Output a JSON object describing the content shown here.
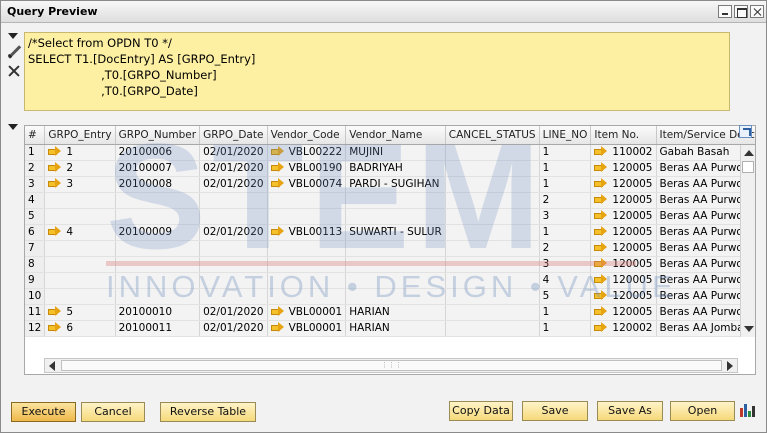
{
  "window": {
    "title": "Query Preview"
  },
  "query": {
    "lines": [
      "/*Select from OPDN T0 */",
      "SELECT T1.[DocEntry] AS [GRPO_Entry]",
      "                    ,T0.[GRPO_Number]",
      "                    ,T0.[GRPO_Date]"
    ]
  },
  "grid": {
    "columns": [
      "#",
      "GRPO_Entry",
      "GRPO_Number",
      "GRPO_Date",
      "Vendor_Code",
      "Vendor_Name",
      "CANCEL_STATUS",
      "LINE_NO",
      "Item No.",
      "Item/Service Descri..."
    ],
    "rows": [
      [
        "1",
        "1",
        "20100006",
        "02/01/2020",
        "VBL00222",
        "MUJINI",
        "",
        "1",
        "110002",
        "Gabah Basah"
      ],
      [
        "2",
        "2",
        "20100007",
        "02/01/2020",
        "VBL00190",
        "BADRIYAH",
        "",
        "1",
        "120005",
        "Beras AA Purwodadi"
      ],
      [
        "3",
        "3",
        "20100008",
        "02/01/2020",
        "VBL00074",
        "PARDI - SUGIHAN",
        "",
        "1",
        "120005",
        "Beras AA Purwodadi"
      ],
      [
        "4",
        "",
        "",
        "",
        "",
        "",
        "",
        "2",
        "120005",
        "Beras AA Purwodadi"
      ],
      [
        "5",
        "",
        "",
        "",
        "",
        "",
        "",
        "3",
        "120005",
        "Beras AA Purwodadi"
      ],
      [
        "6",
        "4",
        "20100009",
        "02/01/2020",
        "VBL00113",
        "SUWARTI - SULUR",
        "",
        "1",
        "120005",
        "Beras AA Purwodadi"
      ],
      [
        "7",
        "",
        "",
        "",
        "",
        "",
        "",
        "2",
        "120005",
        "Beras AA Purwodadi"
      ],
      [
        "8",
        "",
        "",
        "",
        "",
        "",
        "",
        "3",
        "120005",
        "Beras AA Purwodadi"
      ],
      [
        "9",
        "",
        "",
        "",
        "",
        "",
        "",
        "4",
        "120005",
        "Beras AA Purwodadi"
      ],
      [
        "10",
        "",
        "",
        "",
        "",
        "",
        "",
        "5",
        "120005",
        "Beras AA Purwodadi"
      ],
      [
        "11",
        "5",
        "20100010",
        "02/01/2020",
        "VBL00001",
        "HARIAN",
        "",
        "1",
        "120005",
        "Beras AA Purwodadi"
      ],
      [
        "12",
        "6",
        "20100011",
        "02/01/2020",
        "VBL00001",
        "HARIAN",
        "",
        "1",
        "120002",
        "Beras AA Jombang"
      ]
    ]
  },
  "watermark": {
    "big": "STEM",
    "sub": "INNOVATION • DESIGN • VALUE"
  },
  "buttons": {
    "execute": "Execute",
    "cancel": "Cancel",
    "reverse_table": "Reverse Table",
    "copy_data": "Copy Data",
    "save": "Save",
    "save_as": "Save As",
    "open": "Open"
  },
  "icons": [
    "minimize-icon",
    "maximize-icon",
    "close-icon",
    "pencil-icon",
    "clear-query-icon",
    "link-arrow-icon",
    "expand-icon",
    "chart-icon"
  ]
}
